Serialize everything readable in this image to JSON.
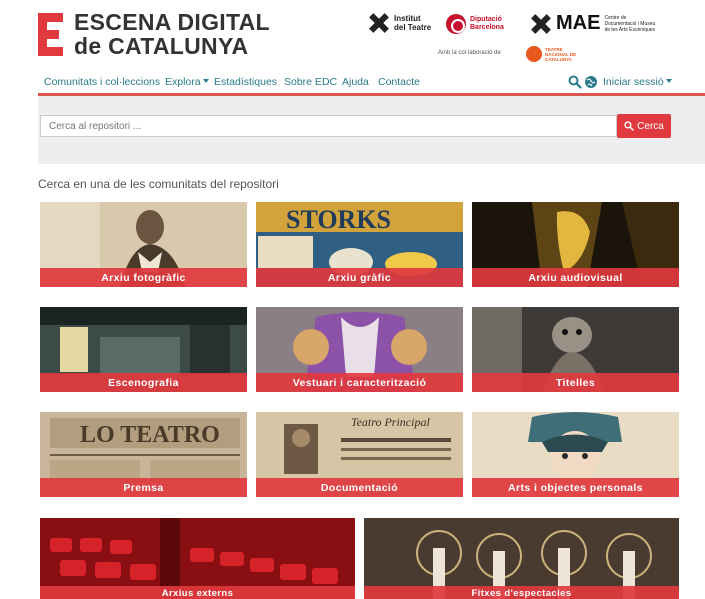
{
  "logo": {
    "line1": "ESCENA DIGITAL",
    "line2": "de CATALUNYA",
    "accent": "#e03a3e"
  },
  "partners": {
    "institut_line1": "Institut",
    "institut_line2": "del Teatre",
    "diputacio_line1": "Diputació",
    "diputacio_line2": "Barcelona",
    "mae": "MAE",
    "mae_sub": "Centre de Documentació i Museu de les Arts Escèniques",
    "collab": "Amb la col·laboració de",
    "tnc": "TEATRE NACIONAL DE CATALUNYA"
  },
  "nav": {
    "items": [
      "Comunitats i col·leccions",
      "Explora",
      "Estadístiques",
      "Sobre EDC",
      "Ajuda",
      "Contacte"
    ],
    "login": "Iniciar sessió",
    "link_color": "#2a7a8c"
  },
  "search": {
    "placeholder": "Cerca al repositori ...",
    "button": "Cerca"
  },
  "intro": "Cerca en una de les comunitats del repositori",
  "communities": [
    "Arxiu fotogràfic",
    "Arxiu gràfic",
    "Arxiu audiovisual",
    "Escenografia",
    "Vestuari i caracterització",
    "Titelles",
    "Premsa",
    "Documentació",
    "Arts i objectes personals",
    "Arxius externs",
    "Fitxes d'espectacles"
  ]
}
